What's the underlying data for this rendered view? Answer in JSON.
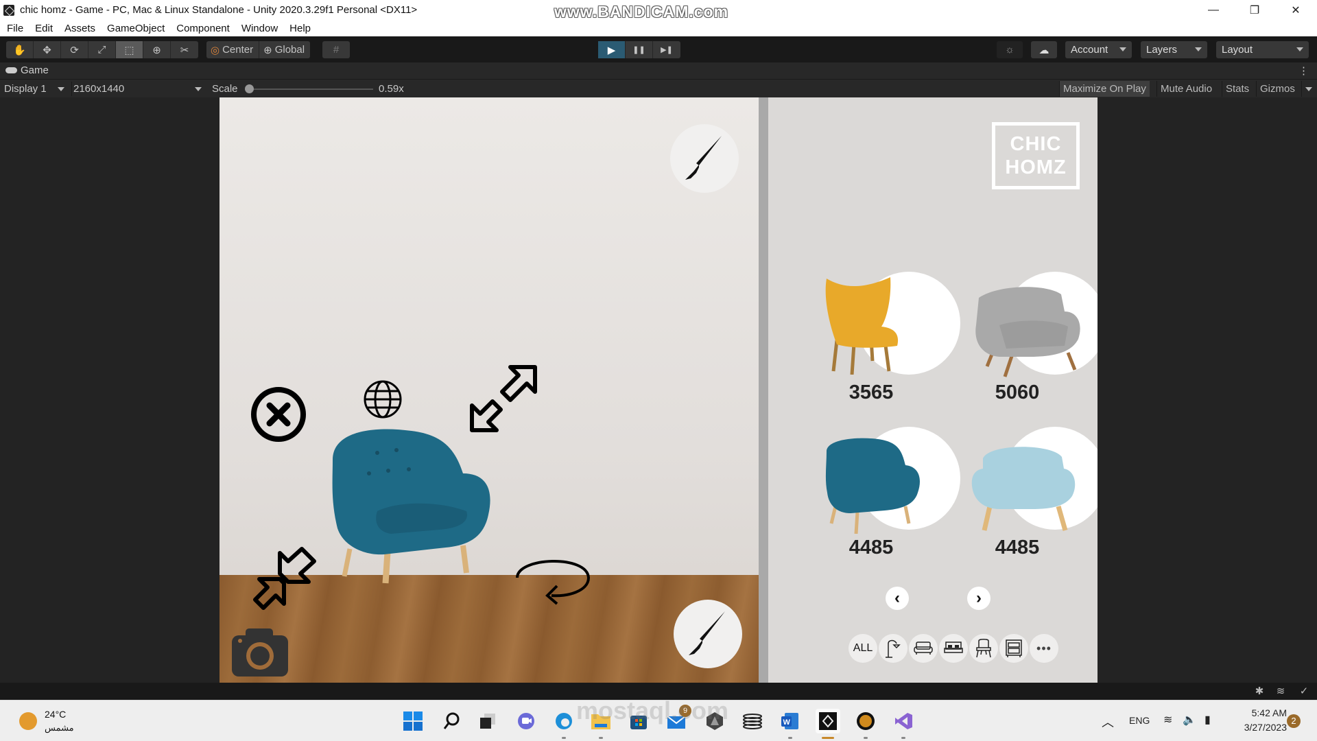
{
  "window": {
    "title": "chic homz - Game - PC, Mac & Linux Standalone - Unity 2020.3.29f1 Personal <DX11>",
    "watermark": "www.BANDICAM.com",
    "controls": {
      "minimize": "—",
      "restore": "❐",
      "close": "✕"
    }
  },
  "menu": [
    "File",
    "Edit",
    "Assets",
    "GameObject",
    "Component",
    "Window",
    "Help"
  ],
  "toolbar": {
    "tools": [
      {
        "name": "hand-tool",
        "glyph": "✋"
      },
      {
        "name": "move-tool",
        "glyph": "✥"
      },
      {
        "name": "rotate-tool",
        "glyph": "⟳"
      },
      {
        "name": "scale-tool",
        "glyph": "⤢"
      },
      {
        "name": "rect-tool",
        "glyph": "⬚",
        "selected": true
      },
      {
        "name": "transform-tool",
        "glyph": "⊕"
      },
      {
        "name": "custom-tool",
        "glyph": "✂"
      }
    ],
    "pivot_label": "Center",
    "space_label": "Global",
    "snap_glyph": "#",
    "play": "▶",
    "pause": "❚❚",
    "step": "▶❚",
    "account_label": "Account",
    "layers_label": "Layers",
    "layout_label": "Layout"
  },
  "game_tab": {
    "label": "Game",
    "kebab": "⋮"
  },
  "display_bar": {
    "display": "Display 1",
    "resolution": "2160x1440",
    "scale_label": "Scale",
    "scale_value": "0.59x",
    "scale_fraction": 0.0,
    "maximize_on_play": "Maximize On Play",
    "mute_audio": "Mute Audio",
    "stats": "Stats",
    "gizmos": "Gizmos"
  },
  "game": {
    "logo_line1": "CHIC",
    "logo_line2": "HOMZ",
    "products": [
      {
        "price": "3565",
        "color": "#e8a92a",
        "name": "yellow-wingback-chair"
      },
      {
        "price": "5060",
        "color": "#a9a9a9",
        "name": "grey-tufted-armchair"
      },
      {
        "price": "4485",
        "color": "#1e6a86",
        "name": "teal-tufted-armchair"
      },
      {
        "price": "4485",
        "color": "#a9d1df",
        "name": "light-blue-armchair"
      }
    ],
    "prev": "‹",
    "next": "›",
    "categories": [
      {
        "label": "ALL",
        "name": "category-all"
      },
      {
        "label": "🛋",
        "name": "category-lamp"
      },
      {
        "label": "",
        "name": "category-sofa"
      },
      {
        "label": "",
        "name": "category-bed"
      },
      {
        "label": "",
        "name": "category-chair"
      },
      {
        "label": "",
        "name": "category-cabinet"
      },
      {
        "label": "•••",
        "name": "category-more"
      }
    ],
    "placed_chair_color": "#1e6a86"
  },
  "taskbar": {
    "weather_temp": "24°C",
    "weather_desc": "مشمس",
    "mail_badge": "9",
    "tray_lang": "ENG",
    "time": "5:42 AM",
    "date": "3/27/2023",
    "notifications": "2",
    "watermark": "mostaql.com"
  }
}
